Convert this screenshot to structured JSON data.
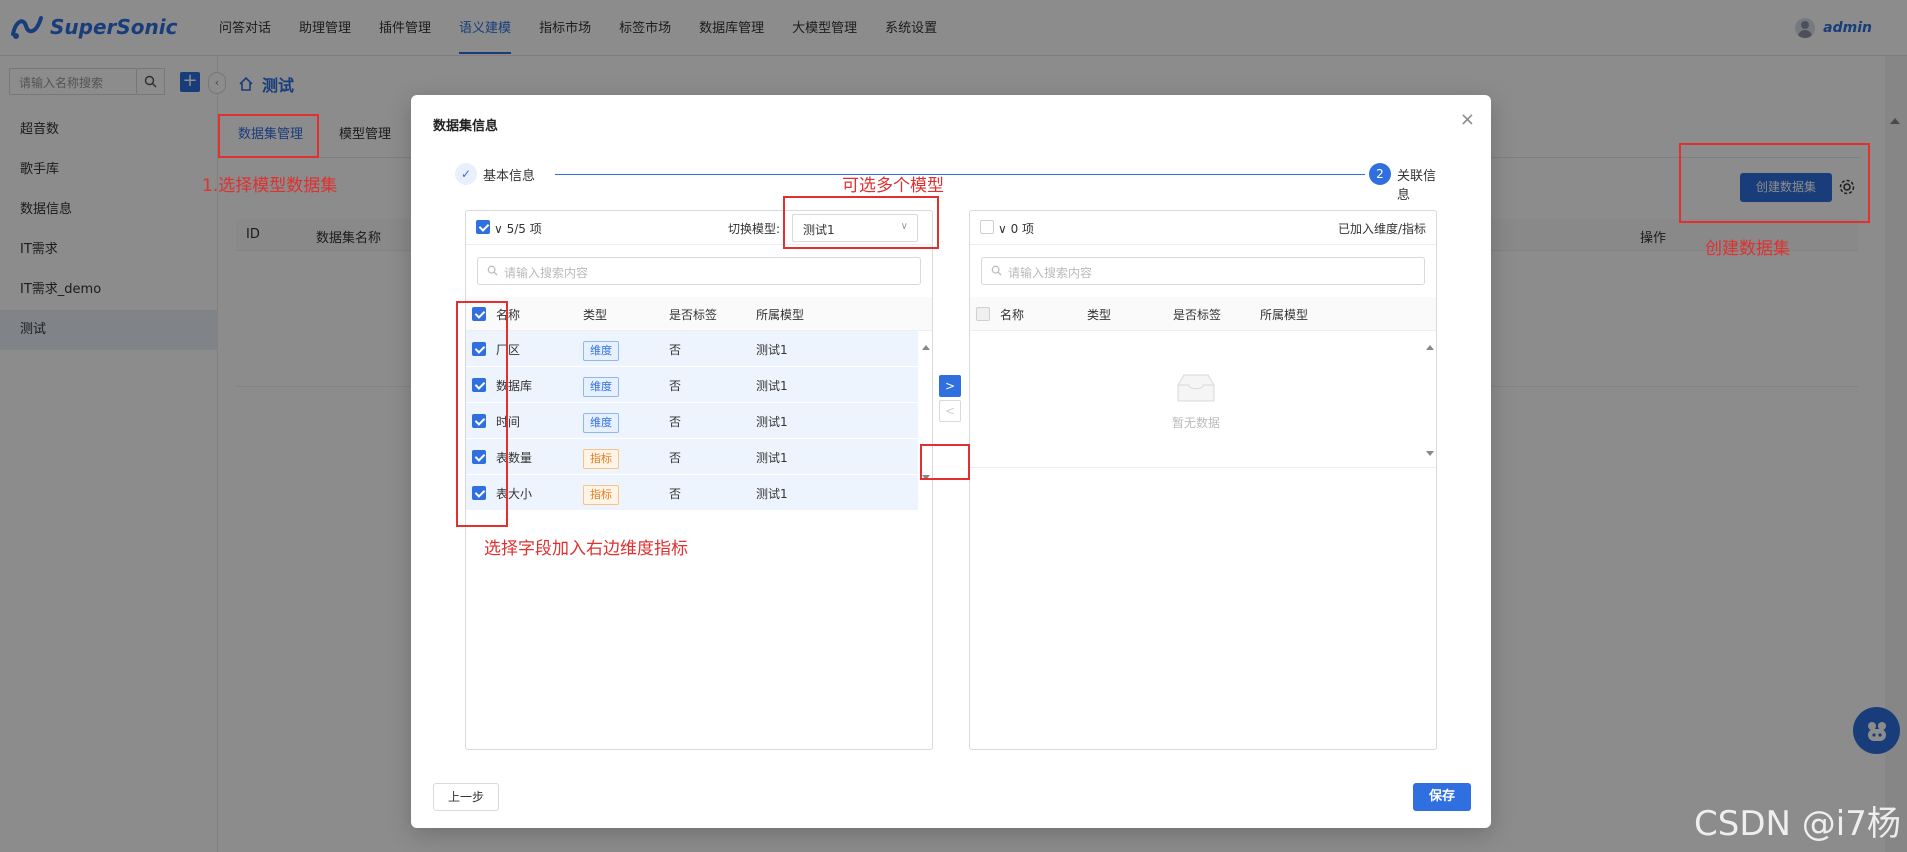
{
  "app": {
    "name": "SuperSonic",
    "user": "admin"
  },
  "nav": [
    "问答对话",
    "助理管理",
    "插件管理",
    "语义建模",
    "指标市场",
    "标签市场",
    "数据库管理",
    "大模型管理",
    "系统设置"
  ],
  "nav_active_index": 3,
  "sidebar": {
    "search_placeholder": "请输入名称搜索",
    "add_label": "+",
    "items": [
      "超音数",
      "歌手库",
      "数据信息",
      "IT需求",
      "IT需求_demo",
      "测试"
    ],
    "active_index": 5
  },
  "main": {
    "title": "测试",
    "tabs": [
      "数据集管理",
      "模型管理"
    ],
    "create_button": "创建数据集",
    "table_headers": [
      "ID",
      "数据集名称",
      "操作"
    ]
  },
  "modal": {
    "title": "数据集信息",
    "close": "×",
    "steps": [
      {
        "icon": "✓",
        "label": "基本信息"
      },
      {
        "icon": "2",
        "label": "关联信息"
      }
    ],
    "left": {
      "count": "5/5 项",
      "switch_label": "切换模型:",
      "switch_value": "测试1",
      "search_placeholder": "请输入搜索内容",
      "headers": [
        "名称",
        "类型",
        "是否标签",
        "所属模型"
      ],
      "rows": [
        {
          "name": "厂区",
          "type": "维度",
          "kind": "dim",
          "is_tag": "否",
          "model": "测试1"
        },
        {
          "name": "数据库",
          "type": "维度",
          "kind": "dim",
          "is_tag": "否",
          "model": "测试1"
        },
        {
          "name": "时间",
          "type": "维度",
          "kind": "dim",
          "is_tag": "否",
          "model": "测试1"
        },
        {
          "name": "表数量",
          "type": "指标",
          "kind": "met",
          "is_tag": "否",
          "model": "测试1"
        },
        {
          "name": "表大小",
          "type": "指标",
          "kind": "met",
          "is_tag": "否",
          "model": "测试1"
        }
      ]
    },
    "right": {
      "count": "0 项",
      "label": "已加入维度/指标",
      "search_placeholder": "请输入搜索内容",
      "headers": [
        "名称",
        "类型",
        "是否标签",
        "所属模型"
      ],
      "empty": "暂无数据"
    },
    "move_right": ">",
    "move_left": "<",
    "prev_button": "上一步",
    "save_button": "保存"
  },
  "annotations": {
    "select_model": "1.选择模型数据集",
    "multi_model": "可选多个模型",
    "select_fields": "选择字段加入右边维度指标",
    "create_dataset": "创建数据集"
  },
  "watermark": "CSDN @i7杨",
  "colors": {
    "primary": "#2f6fe0",
    "annotation": "#e03030",
    "overlay": "rgba(0,0,0,0.45)"
  }
}
